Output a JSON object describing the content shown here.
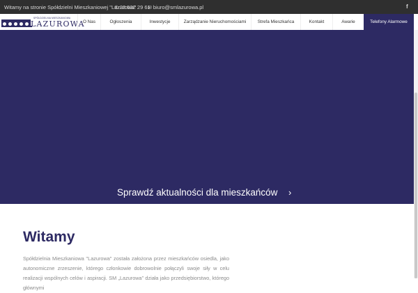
{
  "topbar": {
    "welcome": "Witamy na stronie Spółdzielni Mieszkaniowej \"Lazurowa\"",
    "phone": "22 532 29 61",
    "phone_icon": "phone-icon",
    "email": "biuro@smlazurowa.pl",
    "email_icon": "envelope-icon",
    "social_icon": "facebook-icon",
    "social_glyph": "f"
  },
  "logo": {
    "small_text": "SPÓŁDZIELNIA MIESZKANIOWA",
    "brand": "LAZUROWA"
  },
  "nav": {
    "items": [
      {
        "label": "O Nas"
      },
      {
        "label": "Ogłoszenia"
      },
      {
        "label": "Inwestycje"
      },
      {
        "label": "Zarządzanie Nieruchomościami"
      },
      {
        "label": "Strefa Mieszkańca"
      },
      {
        "label": "Kontakt"
      },
      {
        "label": "Awarie"
      },
      {
        "label": "Telefony Alarmowe"
      }
    ]
  },
  "hero": {
    "link_text": "Sprawdź aktualności dla mieszkańców",
    "arrow": "›"
  },
  "main": {
    "heading": "Witamy",
    "paragraph": "Spółdzielnia Mieszkaniowa \"Lazurowa\" została założona przez mieszkańców osiedla, jako autonomiczne zrzeszenie, którego członkowie dobrowolnie połączyli swoje siły w celu realizacji wspólnych celów i aspiracji. SM „Lazurowa” działa jako przedsiębiorstwo, którego głównymi"
  },
  "colors": {
    "brand": "#2d2a63",
    "topbar": "#2f2f2f"
  }
}
